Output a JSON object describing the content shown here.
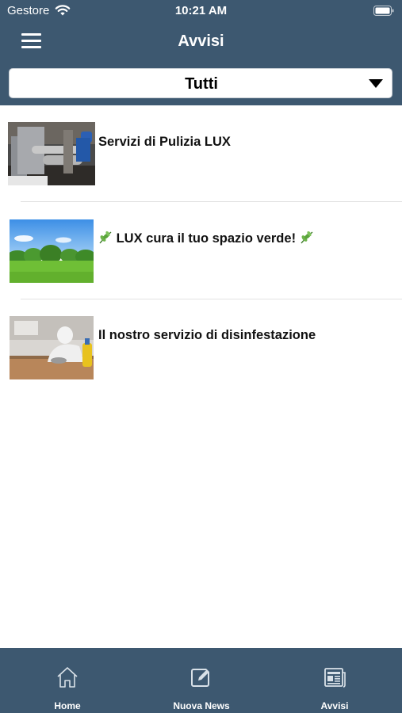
{
  "status": {
    "carrier": "Gestore",
    "time": "10:21 AM"
  },
  "nav": {
    "title": "Avvisi"
  },
  "filter": {
    "selected": "Tutti"
  },
  "items": [
    {
      "title": "Servizi di Pulizia LUX",
      "image": "industrial-cleaning-photo"
    },
    {
      "title": "LUX cura il tuo spazio verde!",
      "image": "green-lawn-photo",
      "decoration": "herb-emoji"
    },
    {
      "title": "Il nostro servizio di disinfestazione",
      "image": "pest-control-photo"
    }
  ],
  "tabs": [
    {
      "label": "Home",
      "icon": "home-icon"
    },
    {
      "label": "Nuova News",
      "icon": "compose-icon"
    },
    {
      "label": "Avvisi",
      "icon": "newspaper-icon"
    }
  ],
  "colors": {
    "primary": "#3d5870",
    "background": "#ffffff",
    "text": "#111111"
  }
}
